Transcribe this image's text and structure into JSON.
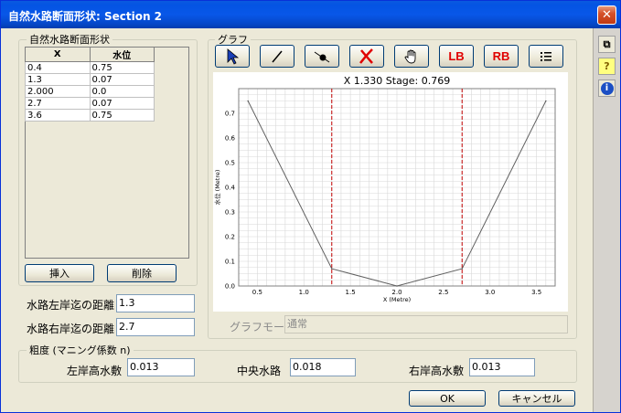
{
  "window": {
    "title": "自然水路断面形状: Section 2",
    "close_glyph": "✕"
  },
  "sidebar": {
    "copy_glyph": "⧉",
    "help_glyph": "?",
    "info_glyph": "i"
  },
  "shape_group": {
    "title": "自然水路断面形状",
    "columns": [
      "X",
      "水位"
    ],
    "rows": [
      [
        "0.4",
        "0.75"
      ],
      [
        "1.3",
        "0.07"
      ],
      [
        "2.000",
        "0.0"
      ],
      [
        "2.7",
        "0.07"
      ],
      [
        "3.6",
        "0.75"
      ]
    ],
    "insert_label": "挿入",
    "delete_label": "削除"
  },
  "left_bank": {
    "label": "水路左岸迄の距離",
    "value": "1.3"
  },
  "right_bank": {
    "label": "水路右岸迄の距離",
    "value": "2.7"
  },
  "graph_group": {
    "title": "グラフ",
    "tools": {
      "lb_label": "LB",
      "rb_label": "RB"
    },
    "mode_label": "グラフモード",
    "mode_value": "通常"
  },
  "chart_data": {
    "type": "line",
    "title": "X 1.330 Stage: 0.769",
    "xlabel": "X (Metre)",
    "ylabel": "水位 (Metre)",
    "xlim": [
      0.3,
      3.7
    ],
    "ylim": [
      0.0,
      0.8
    ],
    "xticks": [
      "0.5",
      "1.0",
      "1.5",
      "2.0",
      "2.5",
      "3.0",
      "3.5"
    ],
    "yticks": [
      "0.0",
      "0.1",
      "0.2",
      "0.3",
      "0.4",
      "0.5",
      "0.6",
      "0.7"
    ],
    "grid": true,
    "series": [
      {
        "x": [
          0.4,
          1.3,
          2.0,
          2.7,
          3.6
        ],
        "y": [
          0.75,
          0.07,
          0.0,
          0.07,
          0.75
        ],
        "color": "#606060"
      }
    ],
    "bank_lines": {
      "x": [
        1.3,
        2.7
      ],
      "color": "#c00000"
    }
  },
  "roughness_group": {
    "title": "粗度 (マニング係数 n)",
    "left_label": "左岸高水敷",
    "left_value": "0.013",
    "main_label": "中央水路",
    "main_value": "0.018",
    "right_label": "右岸高水敷",
    "right_value": "0.013"
  },
  "footer": {
    "ok_label": "OK",
    "cancel_label": "キャンセル"
  }
}
